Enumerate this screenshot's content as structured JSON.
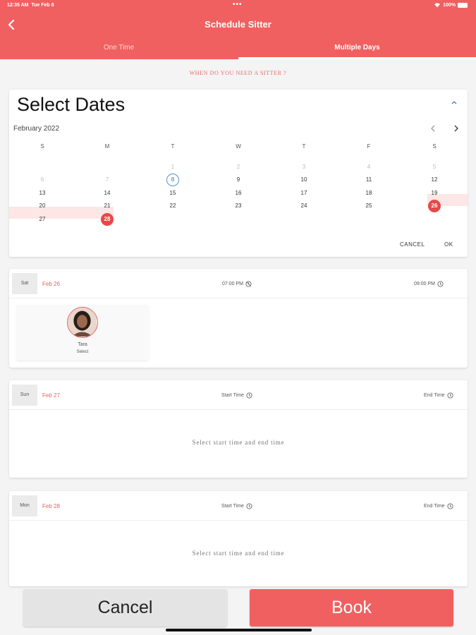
{
  "status": {
    "time": "12:35 AM",
    "date": "Tue Feb 8",
    "dots": "•••",
    "battery": "100%"
  },
  "header": {
    "title": "Schedule Sitter"
  },
  "tabs": [
    {
      "label": "One Time"
    },
    {
      "label": "Multiple Days"
    }
  ],
  "prompt": "WHEN DO YOU NEED A SITTER ?",
  "calendar": {
    "title": "Select Dates",
    "month": "February 2022",
    "weekdays": [
      "S",
      "M",
      "T",
      "W",
      "T",
      "F",
      "S"
    ],
    "weeks": [
      [
        null,
        null,
        "1",
        "2",
        "3",
        "4",
        "5"
      ],
      [
        "6",
        "7",
        "8",
        "9",
        "10",
        "11",
        "12"
      ],
      [
        "13",
        "14",
        "15",
        "16",
        "17",
        "18",
        "19"
      ],
      [
        "20",
        "21",
        "22",
        "23",
        "24",
        "25",
        "26"
      ],
      [
        "27",
        "28",
        null,
        null,
        null,
        null,
        null
      ]
    ],
    "muted_days": [
      "1",
      "2",
      "3",
      "4",
      "5",
      "6",
      "7"
    ],
    "today": "8",
    "range_start": "26",
    "range_end": "28",
    "cancel_label": "CANCEL",
    "ok_label": "OK"
  },
  "days": [
    {
      "weekday": "Sat",
      "date": "Feb 26",
      "start": "07:00 PM",
      "end": "09:00 PM",
      "sitter": {
        "name": "Tara",
        "action": "Select"
      }
    },
    {
      "weekday": "Sun",
      "date": "Feb 27",
      "start": "Start Time",
      "end": "End Time",
      "empty_message": "Select start time and end time"
    },
    {
      "weekday": "Mon",
      "date": "Feb 28",
      "start": "Start Time",
      "end": "End Time",
      "empty_message": "Select start time and end time"
    }
  ],
  "buttons": {
    "cancel": "Cancel",
    "book": "Book"
  },
  "colors": {
    "brand": "#f06060",
    "selected": "#e84848",
    "range": "#fde6e6",
    "today_ring": "#5a8fc7"
  }
}
